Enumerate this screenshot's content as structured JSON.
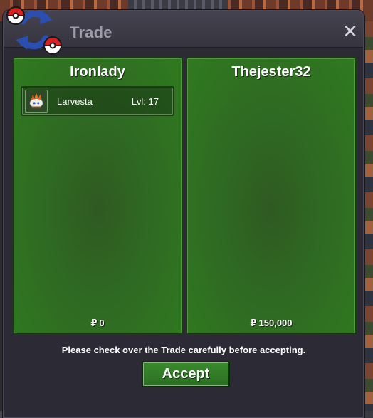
{
  "window": {
    "title": "Trade",
    "close_icon": "close-icon"
  },
  "players": [
    {
      "name": "Ironlady",
      "items": [
        {
          "name": "Larvesta",
          "level": "Lvl: 17",
          "icon": "larvesta-sprite-icon"
        }
      ],
      "currency_symbol": "₽",
      "money": "0"
    },
    {
      "name": "Thejester32",
      "items": [],
      "currency_symbol": "₽",
      "money": "150,000"
    }
  ],
  "notice": "Please check over the Trade carefully before accepting.",
  "accept_label": "Accept",
  "colors": {
    "panel_green": "#2f7a20",
    "window_bg": "#2c2a35",
    "accent_green": "#3a8a2e",
    "pokeball_red": "#d82020",
    "arrow_blue": "#2a4fb0"
  }
}
